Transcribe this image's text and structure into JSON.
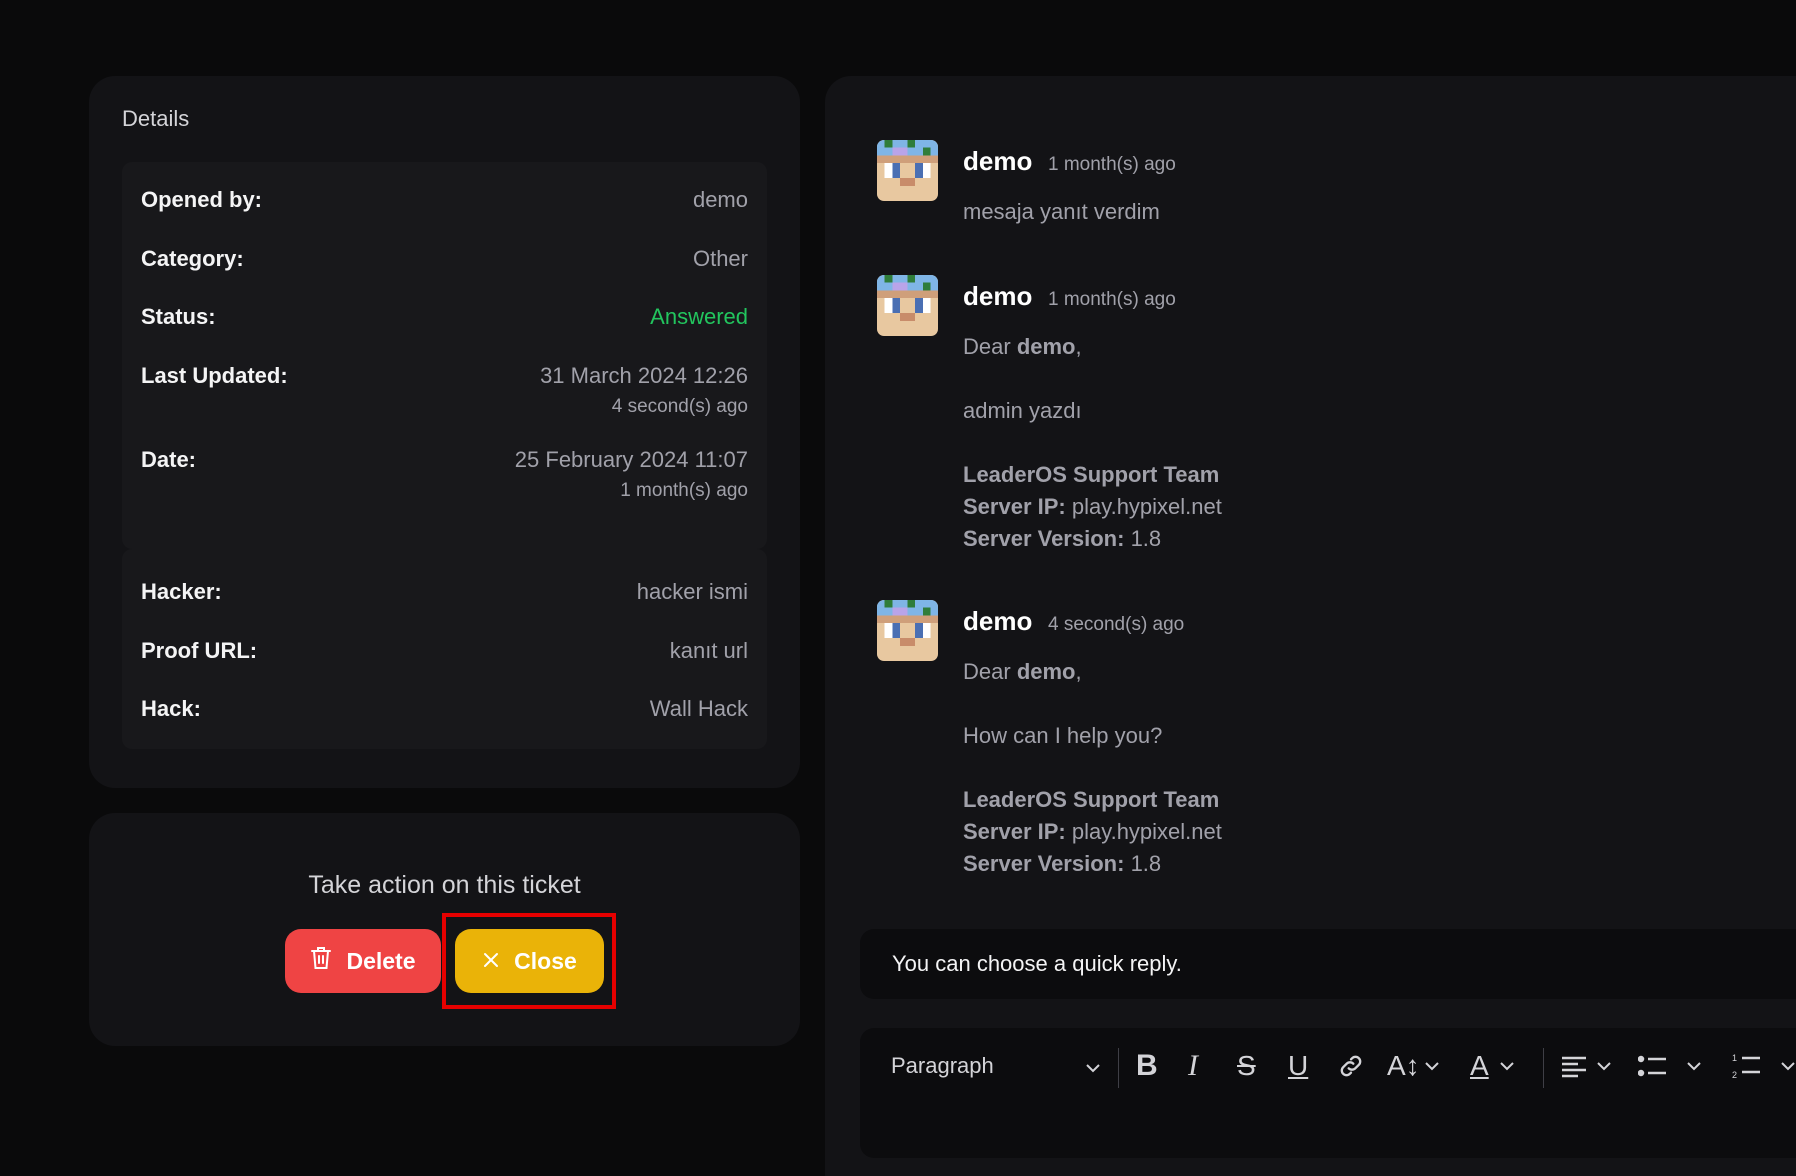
{
  "details": {
    "title": "Details",
    "rows": [
      {
        "label": "Opened by:",
        "value": "demo"
      },
      {
        "label": "Category:",
        "value": "Other"
      },
      {
        "label": "Status:",
        "value": "Answered"
      },
      {
        "label": "Last Updated:",
        "value": "31 March 2024 12:26",
        "sub": "4 second(s) ago"
      },
      {
        "label": "Date:",
        "value": "25 February 2024 11:07",
        "sub": "1 month(s) ago"
      }
    ],
    "extra_rows": [
      {
        "label": "Hacker:",
        "value": "hacker ismi"
      },
      {
        "label": "Proof URL:",
        "value": "kanıt url"
      },
      {
        "label": "Hack:",
        "value": "Wall Hack"
      }
    ],
    "status_color": "#22c55e"
  },
  "actions": {
    "title": "Take action on this ticket",
    "delete_label": "Delete",
    "close_label": "Close",
    "delete_color": "#ef4444",
    "close_color": "#eab308"
  },
  "messages": [
    {
      "author": "demo",
      "time": "1 month(s) ago",
      "body": "mesaja yanıt verdim"
    },
    {
      "author": "demo",
      "time": "1 month(s) ago",
      "dear": "Dear",
      "dear_name": "demo",
      "dear_comma": ",",
      "text": "admin yazdı",
      "team": "LeaderOS Support Team",
      "ip_label": "Server IP:",
      "ip": "play.hypixel.net",
      "ver_label": "Server Version:",
      "ver": "1.8"
    },
    {
      "author": "demo",
      "time": "4 second(s) ago",
      "dear": "Dear",
      "dear_name": "demo",
      "dear_comma": ",",
      "text": "How can I help you?",
      "team": "LeaderOS Support Team",
      "ip_label": "Server IP:",
      "ip": "play.hypixel.net",
      "ver_label": "Server Version:",
      "ver": "1.8"
    }
  ],
  "quick_reply": {
    "placeholder": "You can choose a quick reply."
  },
  "editor": {
    "block_format": "Paragraph"
  }
}
